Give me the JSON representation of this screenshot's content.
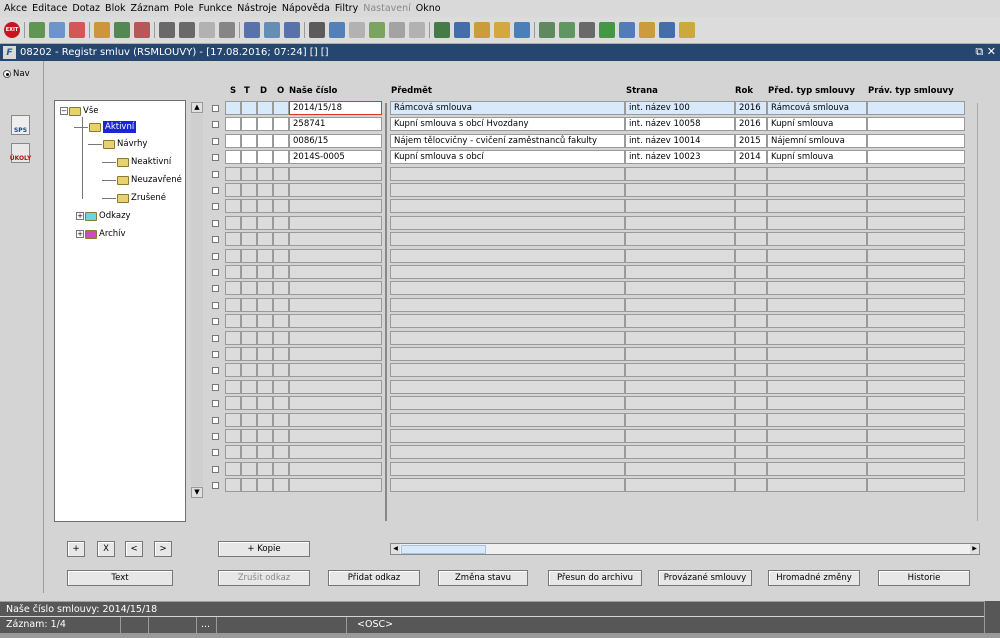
{
  "menu": [
    "Akce",
    "Editace",
    "Dotaz",
    "Blok",
    "Záznam",
    "Pole",
    "Funkce",
    "Nástroje",
    "Nápověda",
    "Filtry",
    "Nastavení",
    "Okno"
  ],
  "menu_disabled": "Nastavení",
  "exit_label": "EXIT",
  "window": {
    "icon": "F",
    "title": "08202 - Registr smluv (RSMLOUVY) - [17.08.2016; 07:24] [] []",
    "controls": "⧉ ✕"
  },
  "nav_label": "Nav",
  "side_icons": [
    "SPS",
    "ÚKOLY"
  ],
  "tree": [
    {
      "label": "Vše",
      "level": 0,
      "color": "#e8d270"
    },
    {
      "label": "Aktivní",
      "level": 1,
      "color": "#e8d270",
      "selected": true
    },
    {
      "label": "Návrhy",
      "level": 1,
      "color": "#e8d270"
    },
    {
      "label": "Neaktivní",
      "level": 1,
      "color": "#e8d270"
    },
    {
      "label": "Neuzavřené",
      "level": 1,
      "color": "#e8d270"
    },
    {
      "label": "Zrušené",
      "level": 1,
      "color": "#e8d270"
    },
    {
      "label": "Odkazy",
      "level": 1,
      "color": "#6ed3e8"
    },
    {
      "label": "Archív",
      "level": 1,
      "color": "#c84ec0"
    }
  ],
  "tree_buttons": [
    "+",
    "X",
    "<",
    ">"
  ],
  "text_button": "Text",
  "headers": [
    "S",
    "T",
    "D",
    "O",
    "Naše číslo",
    "Předmět",
    "Strana",
    "Rok",
    "Před. typ smlouvy",
    "Práv. typ smlouvy"
  ],
  "rows": [
    [
      "2014/15/18",
      "Rámcová smlouva",
      "int. název 100",
      "2016",
      "Rámcová smlouva",
      ""
    ],
    [
      "258741",
      "Kupní smlouva s obcí Hvozdany",
      "int. název 10058",
      "2016",
      "Kupní smlouva",
      ""
    ],
    [
      "0086/15",
      "Nájem tělocvičny - cvičení zaměstnanců fakulty",
      "int. název 10014",
      "2015",
      "Nájemní smlouva",
      ""
    ],
    [
      "2014S-0005",
      "Kupní smlouva s obcí",
      "int. název 10023",
      "2014",
      "Kupní smlouva",
      ""
    ]
  ],
  "empty_rows": 20,
  "kopie_button": "+ Kopie",
  "action_buttons": [
    {
      "label": "Zrušit odkaz",
      "disabled": true
    },
    {
      "label": "Přidat odkaz",
      "disabled": false
    },
    {
      "label": "Změna stavu",
      "disabled": false
    },
    {
      "label": "Přesun do archivu",
      "disabled": false
    },
    {
      "label": "Provázané smlouvy",
      "disabled": false
    },
    {
      "label": "Hromadné změny",
      "disabled": false
    },
    {
      "label": "Historie",
      "disabled": false
    }
  ],
  "status": {
    "hint": "Naše číslo smlouvy: 2014/15/18",
    "record": "Záznam: 1/4",
    "dots": "...",
    "mode": "<OSC>"
  },
  "colors": {
    "title_bar": "#25466f",
    "selected_row": "#d7e9fa",
    "tree_selected": "#1a24d8",
    "status_bar": "#575757"
  }
}
